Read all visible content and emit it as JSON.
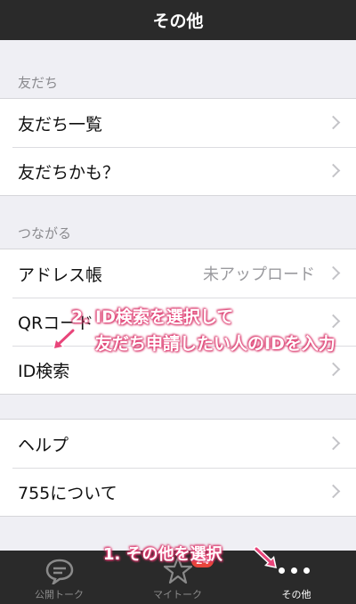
{
  "header": {
    "title": "その他"
  },
  "sections": {
    "friends": {
      "label": "友だち",
      "items": [
        {
          "label": "友だち一覧"
        },
        {
          "label": "友だちかも？"
        }
      ]
    },
    "connect": {
      "label": "つながる",
      "items": [
        {
          "label": "アドレス帳",
          "value": "未アップロード"
        },
        {
          "label": "QRコード"
        },
        {
          "label": "ID検索"
        }
      ]
    },
    "help": {
      "items": [
        {
          "label": "ヘルプ"
        },
        {
          "label": "755について"
        }
      ]
    }
  },
  "tabbar": {
    "tabs": [
      {
        "label": "公開トーク",
        "icon": "speech-bubble-icon"
      },
      {
        "label": "マイトーク",
        "icon": "star-icon",
        "badge": "24"
      },
      {
        "label": "その他",
        "icon": "more-dots-icon",
        "active": true
      }
    ]
  },
  "annotations": {
    "step2_line1": "2. ID検索を選択して",
    "step2_line2": "友だち申請したい人のIDを入力",
    "step1": "1. その他を選択"
  },
  "colors": {
    "header_bg": "#2a2a2a",
    "background": "#efeff4",
    "annotation_pink": "#e8457a",
    "badge_red": "#e8453c"
  }
}
